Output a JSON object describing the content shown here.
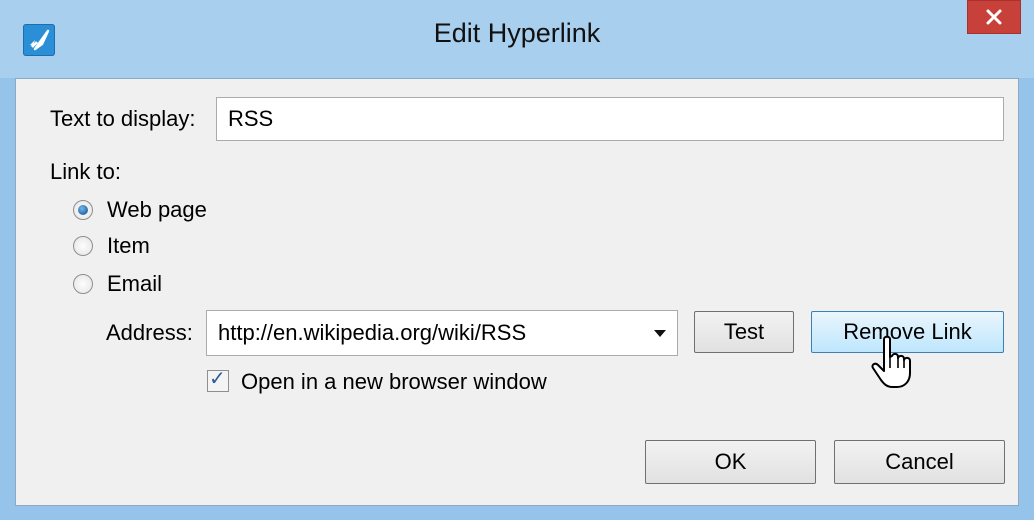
{
  "window": {
    "title": "Edit Hyperlink"
  },
  "form": {
    "text_to_display_label": "Text to display:",
    "text_to_display_value": "RSS",
    "link_to_label": "Link to:",
    "link_options": [
      {
        "label": "Web page",
        "checked": true
      },
      {
        "label": "Item",
        "checked": false
      },
      {
        "label": "Email",
        "checked": false
      }
    ],
    "address_label": "Address:",
    "address_value": "http://en.wikipedia.org/wiki/RSS",
    "open_new_window_label": "Open in a new browser window",
    "open_new_window_checked": true
  },
  "buttons": {
    "test": "Test",
    "remove_link": "Remove Link",
    "ok": "OK",
    "cancel": "Cancel"
  },
  "icons": {
    "app": "rocket-icon",
    "close": "close-icon",
    "dropdown": "chevron-down-icon",
    "cursor": "hand-pointer-icon"
  },
  "colors": {
    "frame": "#96c3ea",
    "close_button": "#c7413a",
    "client_bg": "#f0f0f0",
    "hover_button": "#bee6fd"
  }
}
